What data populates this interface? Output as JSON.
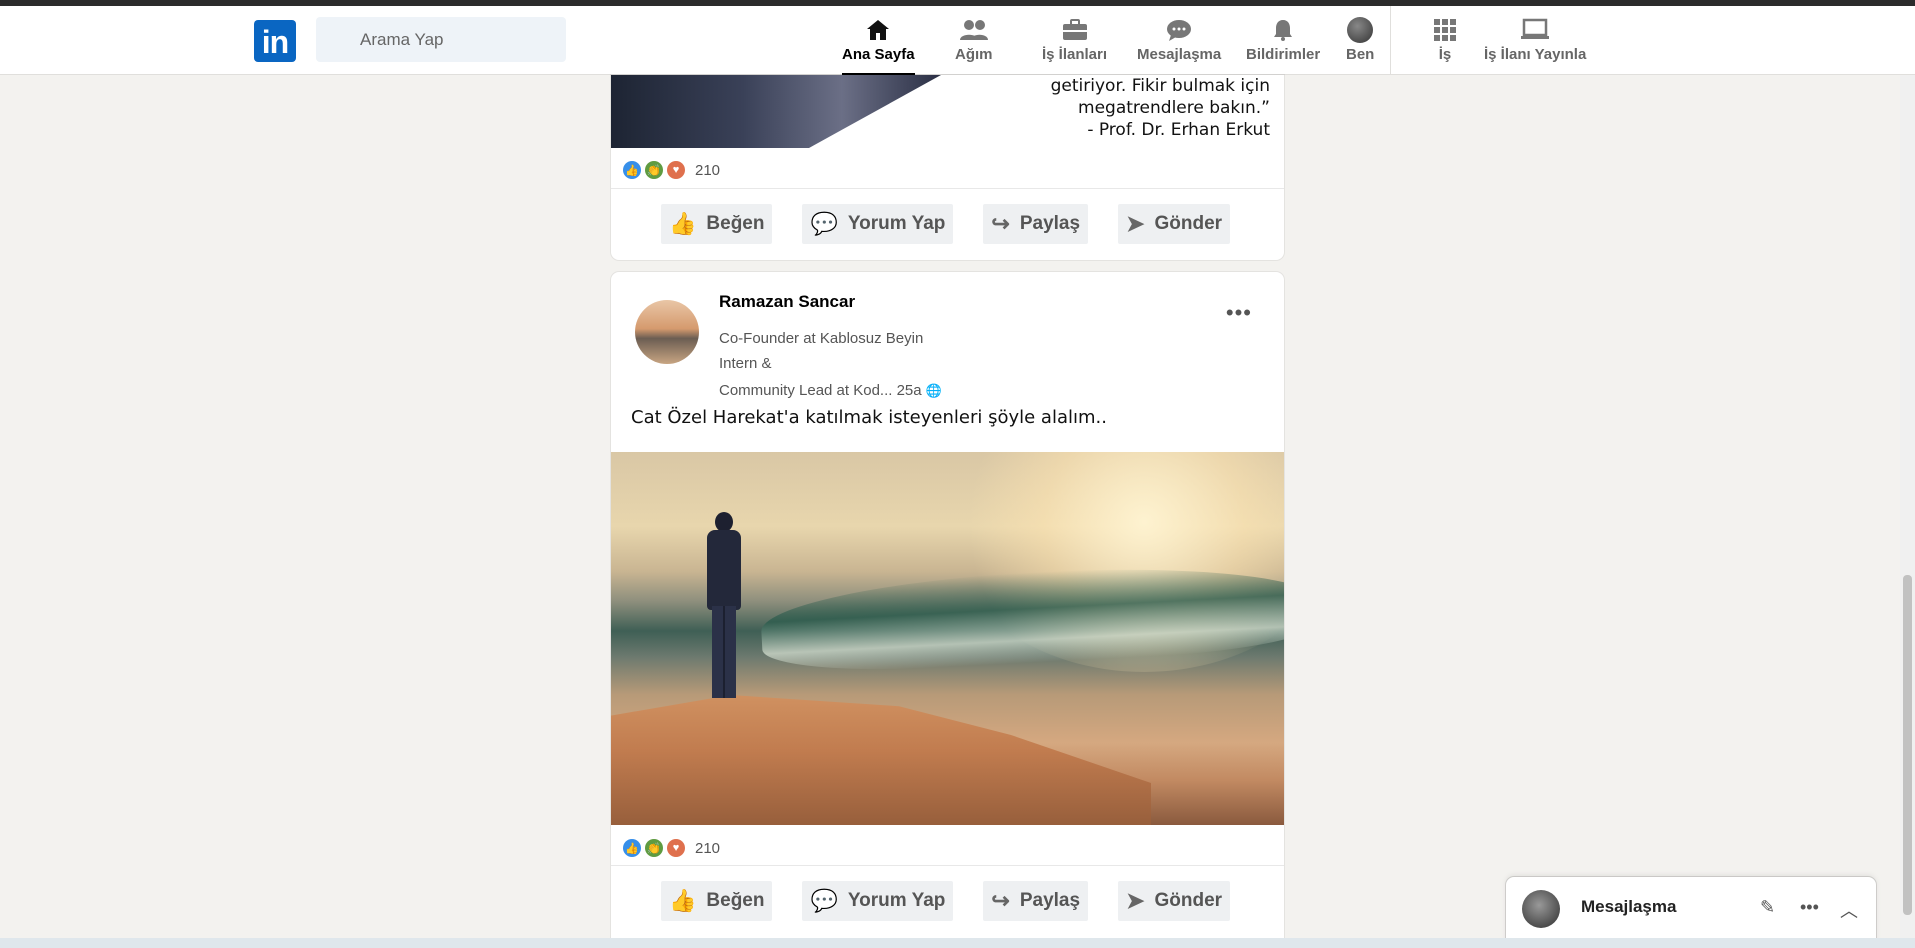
{
  "nav": {
    "search_placeholder": "Arama Yap",
    "items": [
      {
        "label": "Ana Sayfa",
        "icon": "home-icon"
      },
      {
        "label": "Ağım",
        "icon": "network-icon"
      },
      {
        "label": "İş İlanları",
        "icon": "briefcase-icon"
      },
      {
        "label": "Mesajlaşma",
        "icon": "chat-icon"
      },
      {
        "label": "Bildirimler",
        "icon": "bell-icon"
      },
      {
        "label": "Ben",
        "icon": "avatar"
      },
      {
        "label": "İş",
        "icon": "grid-icon"
      },
      {
        "label": "İş İlanı Yayınla",
        "icon": "laptop-icon"
      }
    ]
  },
  "post1": {
    "quote_lines": [
      "getiriyor. Fikir bulmak için",
      "megatrendlere bakın.”",
      "- Prof. Dr. Erhan Erkut"
    ],
    "reaction_count": "210",
    "actions": {
      "like": "Beğen",
      "comment": "Yorum Yap",
      "share": "Paylaş",
      "send": "Gönder"
    }
  },
  "post2": {
    "author": "Ramazan Sancar",
    "headline_1": "Co-Founder at Kablosuz Beyin",
    "headline_2": "Intern &",
    "headline_3": "Community Lead at Kod... 25a",
    "text": "Cat Özel Harekat'a katılmak isteyenleri şöyle alalım..",
    "reaction_count": "210",
    "actions": {
      "like": "Beğen",
      "comment": "Yorum Yap",
      "share": "Paylaş",
      "send": "Gönder"
    }
  },
  "messaging": {
    "title": "Mesajlaşma"
  },
  "colors": {
    "brand": "#0a66c2",
    "background": "#f3f2ef",
    "like": "#378fe9",
    "celebrate": "#5f9b41",
    "love": "#df704d"
  }
}
